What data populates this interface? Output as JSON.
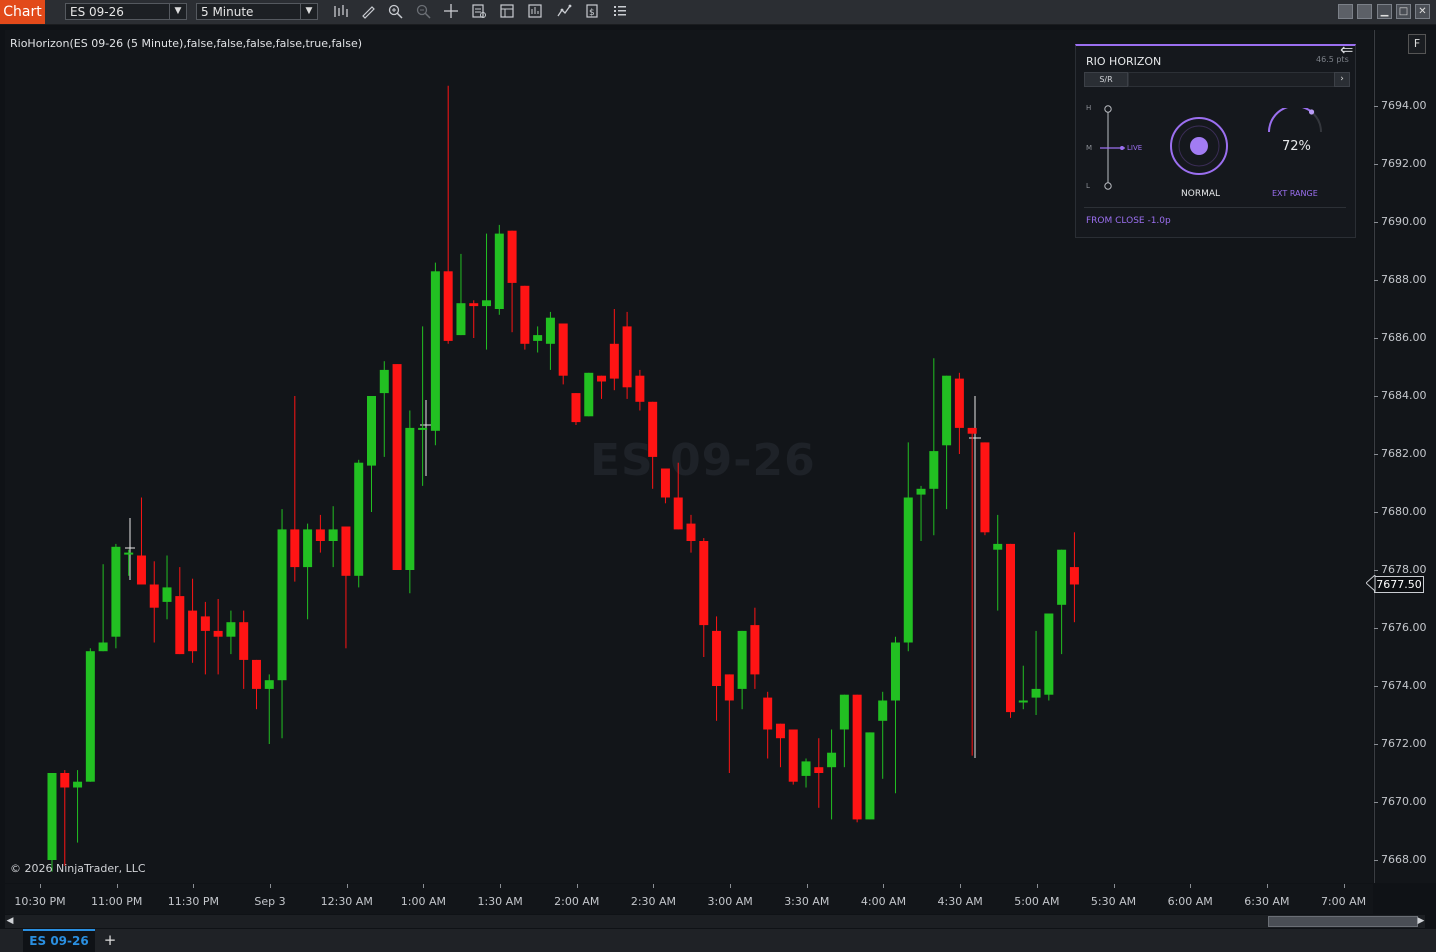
{
  "toolbar": {
    "chart_tab": "Chart",
    "instrument": "ES 09-26",
    "interval": "5 Minute",
    "icons": [
      "bar-type-icon",
      "pencil-icon",
      "zoom-in-icon",
      "zoom-out-icon",
      "crosshair-icon",
      "data-box-icon",
      "properties-icon",
      "strategies-icon",
      "indicators-icon",
      "alerts-icon",
      "templates-icon"
    ]
  },
  "chart": {
    "indicator_label": "RioHorizon(ES 09-26 (5 Minute),false,false,false,false,true,false)",
    "watermark": "ES 09-26",
    "copyright": "© 2026 NinjaTrader, LLC",
    "current_price": "7677.50",
    "f_button": "F",
    "y_ticks": [
      "7694.00",
      "7692.00",
      "7690.00",
      "7688.00",
      "7686.00",
      "7684.00",
      "7682.00",
      "7680.00",
      "7678.00",
      "7676.00",
      "7674.00",
      "7672.00",
      "7670.00",
      "7668.00"
    ],
    "x_ticks": [
      "10:30 PM",
      "11:00 PM",
      "11:30 PM",
      "Sep 3",
      "12:30 AM",
      "1:00 AM",
      "1:30 AM",
      "2:00 AM",
      "2:30 AM",
      "3:00 AM",
      "3:30 AM",
      "4:00 AM",
      "4:30 AM",
      "5:00 AM",
      "5:30 AM",
      "6:00 AM",
      "6:30 AM",
      "7:00 AM"
    ],
    "colors": {
      "up": "#22c022",
      "down": "#ff1414",
      "wick_up": "#22c022",
      "wick_down": "#ff1414"
    }
  },
  "chart_data": {
    "type": "candlestick",
    "ylim": [
      7667.3,
      7696.6
    ],
    "x_origin_time": "10:30 PM",
    "x_unit": "5-minute bars",
    "candles": [
      {
        "o": 7668.0,
        "h": 7671.0,
        "l": 7667.6,
        "c": 7671.0
      },
      {
        "o": 7671.0,
        "h": 7671.1,
        "l": 7667.8,
        "c": 7670.5
      },
      {
        "o": 7670.5,
        "h": 7671.1,
        "l": 7668.6,
        "c": 7670.7
      },
      {
        "o": 7670.7,
        "h": 7675.3,
        "l": 7670.7,
        "c": 7675.2
      },
      {
        "o": 7675.2,
        "h": 7678.2,
        "l": 7675.2,
        "c": 7675.5
      },
      {
        "o": 7675.7,
        "h": 7678.9,
        "l": 7675.3,
        "c": 7678.8
      },
      {
        "o": 7678.6,
        "h": 7678.7,
        "l": 7677.8,
        "c": 7678.6
      },
      {
        "o": 7678.5,
        "h": 7680.5,
        "l": 7678.0,
        "c": 7677.5
      },
      {
        "o": 7677.5,
        "h": 7678.3,
        "l": 7675.5,
        "c": 7676.7
      },
      {
        "o": 7676.9,
        "h": 7678.5,
        "l": 7676.3,
        "c": 7677.4
      },
      {
        "o": 7677.1,
        "h": 7678.1,
        "l": 7675.1,
        "c": 7675.1
      },
      {
        "o": 7676.6,
        "h": 7677.7,
        "l": 7674.8,
        "c": 7675.2
      },
      {
        "o": 7676.4,
        "h": 7676.9,
        "l": 7674.4,
        "c": 7675.9
      },
      {
        "o": 7675.9,
        "h": 7677.0,
        "l": 7674.4,
        "c": 7675.7
      },
      {
        "o": 7675.7,
        "h": 7676.6,
        "l": 7675.1,
        "c": 7676.2
      },
      {
        "o": 7676.2,
        "h": 7676.6,
        "l": 7673.9,
        "c": 7674.9
      },
      {
        "o": 7674.9,
        "h": 7674.9,
        "l": 7673.2,
        "c": 7673.9
      },
      {
        "o": 7673.9,
        "h": 7674.4,
        "l": 7672.0,
        "c": 7674.2
      },
      {
        "o": 7674.2,
        "h": 7680.1,
        "l": 7672.2,
        "c": 7679.4
      },
      {
        "o": 7679.4,
        "h": 7684.0,
        "l": 7677.6,
        "c": 7678.1
      },
      {
        "o": 7678.1,
        "h": 7679.6,
        "l": 7676.3,
        "c": 7679.4
      },
      {
        "o": 7679.4,
        "h": 7679.9,
        "l": 7678.6,
        "c": 7679.0
      },
      {
        "o": 7679.0,
        "h": 7680.2,
        "l": 7678.1,
        "c": 7679.4
      },
      {
        "o": 7679.5,
        "h": 7679.5,
        "l": 7675.3,
        "c": 7677.8
      },
      {
        "o": 7677.8,
        "h": 7681.8,
        "l": 7677.4,
        "c": 7681.7
      },
      {
        "o": 7681.6,
        "h": 7683.9,
        "l": 7680.0,
        "c": 7684.0
      },
      {
        "o": 7684.1,
        "h": 7685.2,
        "l": 7681.9,
        "c": 7684.9
      },
      {
        "o": 7685.1,
        "h": 7685.1,
        "l": 7678.0,
        "c": 7678.0
      },
      {
        "o": 7678.0,
        "h": 7683.5,
        "l": 7677.2,
        "c": 7682.9
      },
      {
        "o": 7682.9,
        "h": 7686.4,
        "l": 7680.9,
        "c": 7682.9
      },
      {
        "o": 7682.8,
        "h": 7688.6,
        "l": 7682.3,
        "c": 7688.3
      },
      {
        "o": 7688.3,
        "h": 7694.7,
        "l": 7685.8,
        "c": 7685.9
      },
      {
        "o": 7686.1,
        "h": 7688.9,
        "l": 7686.1,
        "c": 7687.2
      },
      {
        "o": 7687.2,
        "h": 7687.3,
        "l": 7686.0,
        "c": 7687.1
      },
      {
        "o": 7687.1,
        "h": 7689.6,
        "l": 7685.6,
        "c": 7687.3
      },
      {
        "o": 7687.0,
        "h": 7689.9,
        "l": 7686.8,
        "c": 7689.6
      },
      {
        "o": 7689.7,
        "h": 7689.7,
        "l": 7686.2,
        "c": 7687.9
      },
      {
        "o": 7687.8,
        "h": 7687.8,
        "l": 7685.6,
        "c": 7685.8
      },
      {
        "o": 7685.9,
        "h": 7686.4,
        "l": 7685.5,
        "c": 7686.1
      },
      {
        "o": 7685.8,
        "h": 7686.9,
        "l": 7684.9,
        "c": 7686.7
      },
      {
        "o": 7686.5,
        "h": 7686.5,
        "l": 7684.4,
        "c": 7684.7
      },
      {
        "o": 7684.1,
        "h": 7684.1,
        "l": 7683.0,
        "c": 7683.1
      },
      {
        "o": 7683.3,
        "h": 7684.5,
        "l": 7683.4,
        "c": 7684.8
      },
      {
        "o": 7684.7,
        "h": 7684.6,
        "l": 7683.9,
        "c": 7684.5
      },
      {
        "o": 7685.8,
        "h": 7687.0,
        "l": 7684.2,
        "c": 7684.6
      },
      {
        "o": 7686.4,
        "h": 7686.9,
        "l": 7683.9,
        "c": 7684.3
      },
      {
        "o": 7684.7,
        "h": 7684.9,
        "l": 7683.5,
        "c": 7683.8
      },
      {
        "o": 7683.8,
        "h": 7683.5,
        "l": 7680.8,
        "c": 7681.9
      },
      {
        "o": 7681.5,
        "h": 7681.5,
        "l": 7680.3,
        "c": 7680.5
      },
      {
        "o": 7680.5,
        "h": 7681.7,
        "l": 7679.4,
        "c": 7679.4
      },
      {
        "o": 7679.6,
        "h": 7679.9,
        "l": 7678.6,
        "c": 7679.0
      },
      {
        "o": 7679.0,
        "h": 7679.1,
        "l": 7675.0,
        "c": 7676.1
      },
      {
        "o": 7675.9,
        "h": 7676.4,
        "l": 7672.8,
        "c": 7674.0
      },
      {
        "o": 7674.4,
        "h": 7673.4,
        "l": 7671.0,
        "c": 7673.5
      },
      {
        "o": 7673.9,
        "h": 7675.9,
        "l": 7673.2,
        "c": 7675.9
      },
      {
        "o": 7676.1,
        "h": 7676.7,
        "l": 7673.9,
        "c": 7674.4
      },
      {
        "o": 7673.6,
        "h": 7673.8,
        "l": 7671.5,
        "c": 7672.5
      },
      {
        "o": 7672.7,
        "h": 7672.6,
        "l": 7671.2,
        "c": 7672.2
      },
      {
        "o": 7672.5,
        "h": 7672.5,
        "l": 7670.6,
        "c": 7670.7
      },
      {
        "o": 7670.9,
        "h": 7671.5,
        "l": 7670.5,
        "c": 7671.4
      },
      {
        "o": 7671.2,
        "h": 7672.2,
        "l": 7669.8,
        "c": 7671.0
      },
      {
        "o": 7671.2,
        "h": 7672.5,
        "l": 7669.4,
        "c": 7671.7
      },
      {
        "o": 7672.5,
        "h": 7673.7,
        "l": 7671.2,
        "c": 7673.7
      },
      {
        "o": 7673.7,
        "h": 7673.7,
        "l": 7669.3,
        "c": 7669.4
      },
      {
        "o": 7669.4,
        "h": 7672.1,
        "l": 7669.4,
        "c": 7672.4
      },
      {
        "o": 7672.8,
        "h": 7673.8,
        "l": 7670.8,
        "c": 7673.5
      },
      {
        "o": 7673.5,
        "h": 7675.7,
        "l": 7670.3,
        "c": 7675.5
      },
      {
        "o": 7675.5,
        "h": 7682.4,
        "l": 7675.2,
        "c": 7680.5
      },
      {
        "o": 7680.6,
        "h": 7680.9,
        "l": 7679.0,
        "c": 7680.8
      },
      {
        "o": 7680.8,
        "h": 7685.3,
        "l": 7679.2,
        "c": 7682.1
      },
      {
        "o": 7682.3,
        "h": 7684.6,
        "l": 7680.1,
        "c": 7684.7
      },
      {
        "o": 7684.6,
        "h": 7684.8,
        "l": 7682.0,
        "c": 7682.9
      },
      {
        "o": 7682.9,
        "h": 7682.3,
        "l": 7671.6,
        "c": 7682.7
      },
      {
        "o": 7682.4,
        "h": 7682.4,
        "l": 7679.2,
        "c": 7679.3
      },
      {
        "o": 7678.7,
        "h": 7679.9,
        "l": 7676.6,
        "c": 7678.9
      },
      {
        "o": 7678.9,
        "h": 7678.9,
        "l": 7672.9,
        "c": 7673.1
      },
      {
        "o": 7673.5,
        "h": 7674.7,
        "l": 7673.2,
        "c": 7673.5
      },
      {
        "o": 7673.6,
        "h": 7675.9,
        "l": 7673.0,
        "c": 7673.9
      },
      {
        "o": 7673.7,
        "h": 7675.3,
        "l": 7673.5,
        "c": 7676.5
      },
      {
        "o": 7676.8,
        "h": 7678.5,
        "l": 7675.1,
        "c": 7678.7
      },
      {
        "o": 7678.1,
        "h": 7679.3,
        "l": 7676.2,
        "c": 7677.5
      }
    ]
  },
  "panel": {
    "title": "RIO HORIZON",
    "points": "46.5 pts",
    "back_icon": "back-arrow-icon",
    "tab": "S/R",
    "next_icon": "chevron-right-icon",
    "slider_high": "H",
    "slider_mid": "M",
    "slider_low": "L",
    "live_label": "LIVE",
    "status": "NORMAL",
    "percent": "72%",
    "percent_value": 0.72,
    "ext_label": "EXT RANGE",
    "from_close": "FROM CLOSE -1.0p",
    "accent": "#9b6ff0"
  },
  "tabs": {
    "active": "ES 09-26",
    "add": "+"
  }
}
